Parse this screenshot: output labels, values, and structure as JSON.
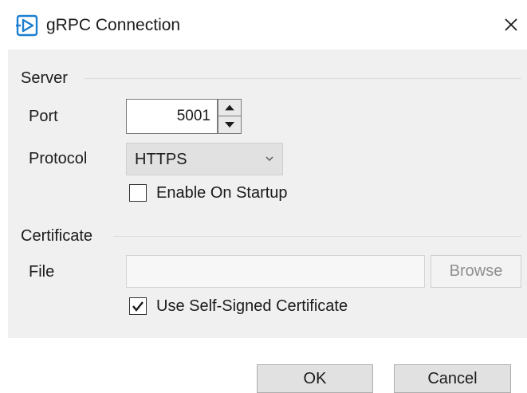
{
  "window": {
    "title": "gRPC Connection",
    "icon": "grpc-app-icon",
    "close_icon": "close-icon"
  },
  "server": {
    "section_label": "Server",
    "port_label": "Port",
    "port_value": "5001",
    "protocol_label": "Protocol",
    "protocol_value": "HTTPS",
    "enable_on_startup_label": "Enable On Startup",
    "enable_on_startup_checked": false
  },
  "certificate": {
    "section_label": "Certificate",
    "file_label": "File",
    "file_value": "",
    "browse_label": "Browse",
    "use_self_signed_label": "Use Self-Signed Certificate",
    "use_self_signed_checked": true
  },
  "buttons": {
    "ok_label": "OK",
    "cancel_label": "Cancel"
  },
  "colors": {
    "icon_accent": "#1d7fcf",
    "dialog_background": "#f0f0f0",
    "checkbox_check": "#1b1b1b"
  }
}
